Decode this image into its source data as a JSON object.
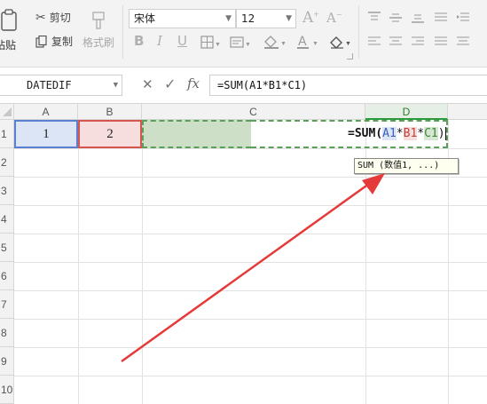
{
  "ribbon": {
    "paste_label": "粘贴",
    "cut_label": "剪切",
    "copy_label": "复制",
    "format_painter_label": "格式刷",
    "font_name": "宋体",
    "font_size": "12"
  },
  "formula_bar": {
    "name_box": "DATEDIF",
    "cancel_icon": "✕",
    "enter_icon": "✓",
    "fx_label": "fx",
    "formula": "=SUM(A1*B1*C1)"
  },
  "grid": {
    "columns": [
      "A",
      "B",
      "C",
      "D"
    ],
    "rows": [
      "1",
      "2",
      "3",
      "4",
      "5",
      "6",
      "7",
      "8",
      "9",
      "10"
    ],
    "active_column": "D",
    "cells": {
      "A1": "1",
      "B1": "2",
      "C1": "",
      "D1_parts": {
        "prefix": "=SUM",
        "open": "(",
        "ref1": "A1",
        "op1": "*",
        "ref2": "B1",
        "op2": "*",
        "ref3": "C1",
        "close": ")"
      }
    },
    "tooltip": "SUM (数值1, ...)"
  },
  "colors": {
    "ref_a1": "#4a72c8",
    "ref_b1": "#d9534f",
    "ref_c1": "#5aa05a",
    "active_header": "#2b9a3c",
    "arrow": "#e53a3a"
  },
  "icons": {
    "paste": "clipboard-icon",
    "cut": "scissors-icon",
    "copy": "copy-icon",
    "format_painter": "brush-icon",
    "bold": "bold-icon",
    "italic": "italic-icon",
    "underline": "underline-icon",
    "border": "border-icon",
    "cell_style": "cell-style-icon",
    "fill": "fill-color-icon",
    "font_color": "font-color-icon",
    "clear": "eraser-icon",
    "grow_font": "grow-font-icon",
    "shrink_font": "shrink-font-icon"
  }
}
